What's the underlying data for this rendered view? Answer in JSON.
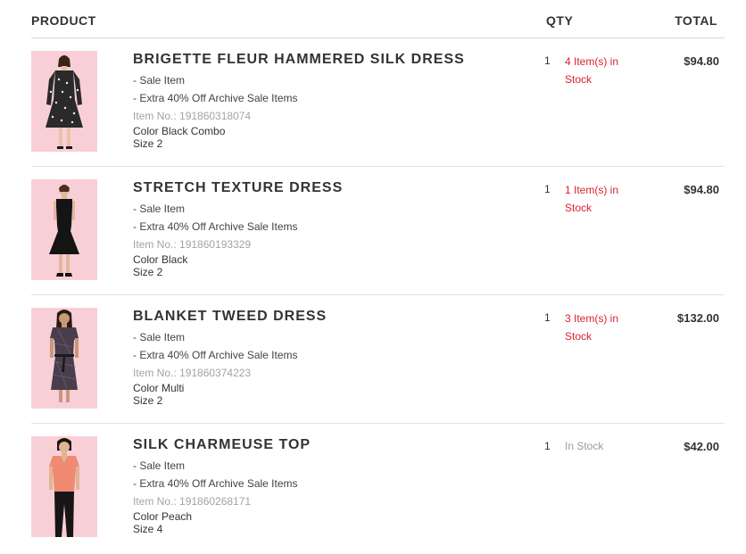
{
  "header": {
    "product": "PRODUCT",
    "qty": "QTY",
    "total": "TOTAL"
  },
  "items": [
    {
      "name": "BRIGETTE FLEUR HAMMERED SILK DRESS",
      "sale": "- Sale Item",
      "promo": "- Extra 40% Off Archive Sale Items",
      "item_no": "Item No.: 191860318074",
      "color": "Color Black Combo",
      "size": "Size 2",
      "qty": "1",
      "stock": "4 Item(s) in Stock",
      "total": "$94.80",
      "dress_color": "#2a2a2a"
    },
    {
      "name": "STRETCH TEXTURE DRESS",
      "sale": "- Sale Item",
      "promo": "- Extra 40% Off Archive Sale Items",
      "item_no": "Item No.: 191860193329",
      "color": "Color Black",
      "size": "Size 2",
      "qty": "1",
      "stock": "1 Item(s) in Stock",
      "total": "$94.80",
      "dress_color": "#141414"
    },
    {
      "name": "BLANKET TWEED DRESS",
      "sale": "- Sale Item",
      "promo": "- Extra 40% Off Archive Sale Items",
      "item_no": "Item No.: 191860374223",
      "color": "Color Multi",
      "size": "Size 2",
      "qty": "1",
      "stock": "3 Item(s) in Stock",
      "total": "$132.00",
      "dress_color": "#4a3d4c"
    },
    {
      "name": "SILK CHARMEUSE TOP",
      "sale": "- Sale Item",
      "promo": "- Extra 40% Off Archive Sale Items",
      "item_no": "Item No.: 191860268171",
      "color": "Color Peach",
      "size": "Size 4",
      "qty": "1",
      "stock": "In Stock",
      "total": "$42.00",
      "dress_color": "#f08a72"
    }
  ],
  "colors": {
    "low_stock": "#d9232e",
    "in_stock": "#9a9a9a",
    "thumb_bg": "#f9cfd7"
  }
}
